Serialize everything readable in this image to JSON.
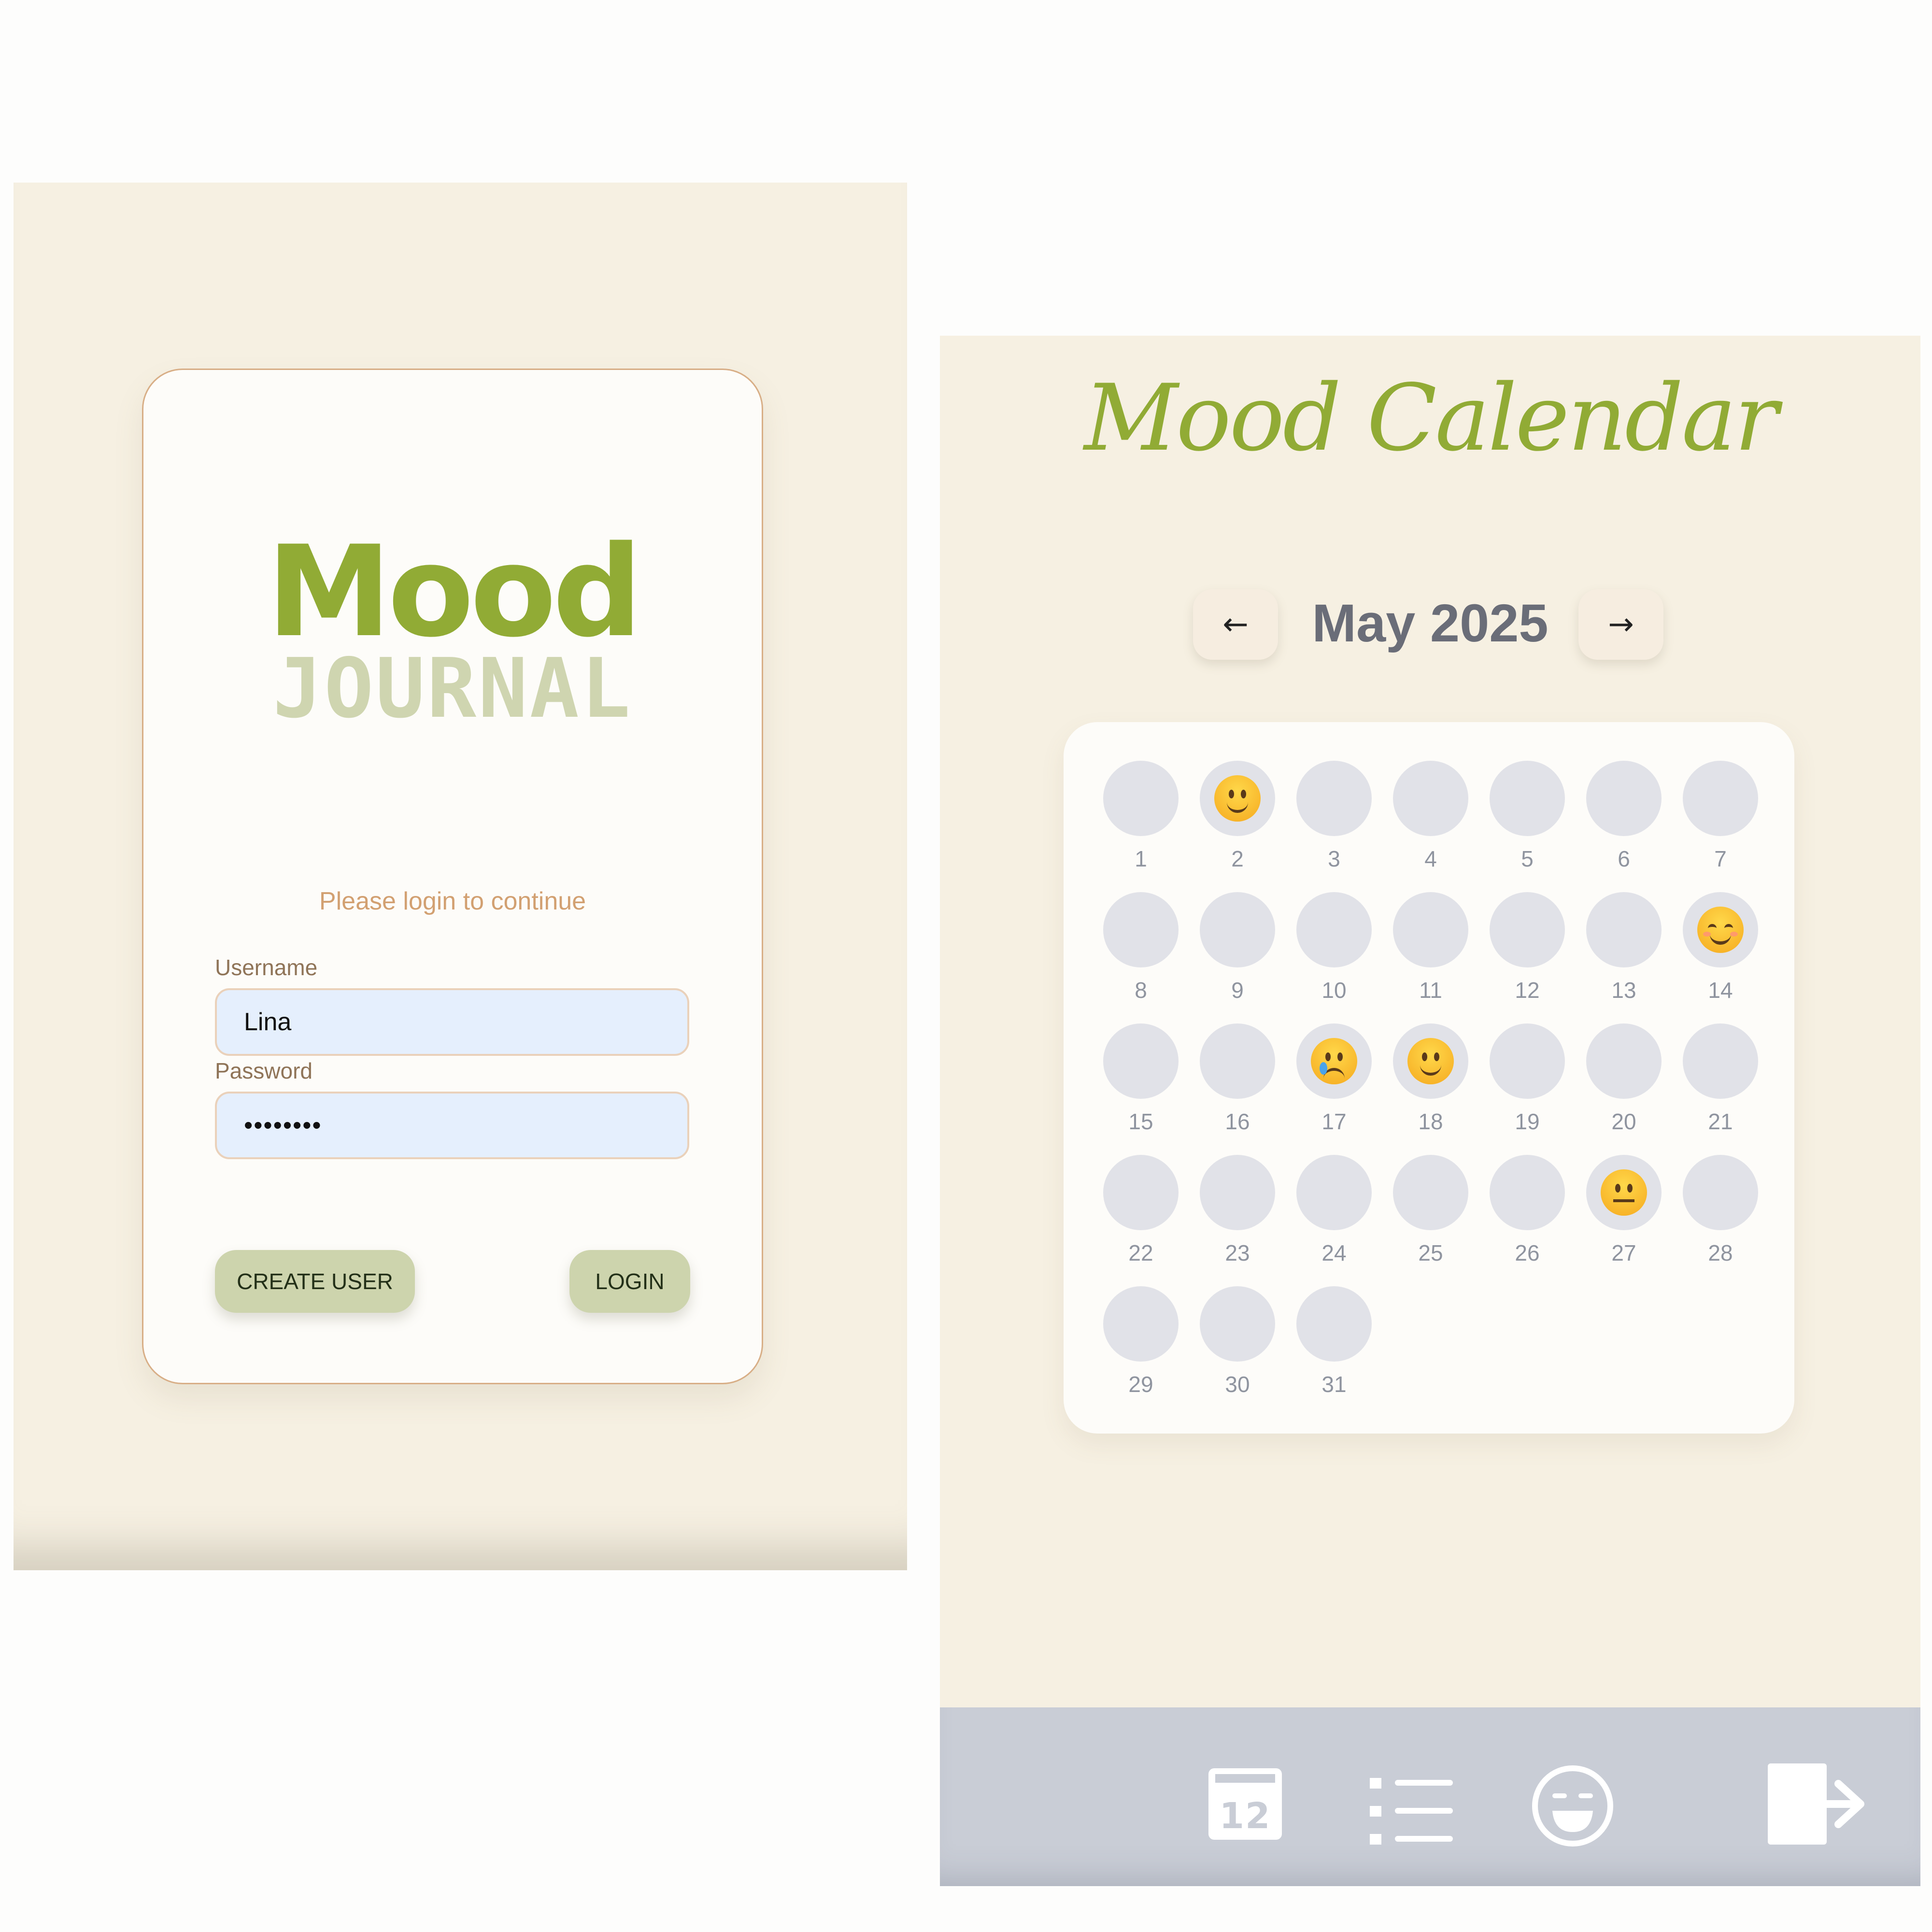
{
  "login": {
    "logo_top": "Mood",
    "logo_bottom": "JOURNAL",
    "prompt": "Please login to continue",
    "username_label": "Username",
    "username_value": "Lina",
    "password_label": "Password",
    "password_value": "••••••••",
    "create_user_label": "CREATE USER",
    "login_label": "LOGIN"
  },
  "calendar": {
    "title": "Mood Calendar",
    "month": "May 2025",
    "prev_label": "←",
    "next_label": "→",
    "days": [
      {
        "day": "1",
        "mood": ""
      },
      {
        "day": "2",
        "mood": "slight-smile"
      },
      {
        "day": "3",
        "mood": ""
      },
      {
        "day": "4",
        "mood": ""
      },
      {
        "day": "5",
        "mood": ""
      },
      {
        "day": "6",
        "mood": ""
      },
      {
        "day": "7",
        "mood": ""
      },
      {
        "day": "8",
        "mood": ""
      },
      {
        "day": "9",
        "mood": ""
      },
      {
        "day": "10",
        "mood": ""
      },
      {
        "day": "11",
        "mood": ""
      },
      {
        "day": "12",
        "mood": ""
      },
      {
        "day": "13",
        "mood": ""
      },
      {
        "day": "14",
        "mood": "smiling"
      },
      {
        "day": "15",
        "mood": ""
      },
      {
        "day": "16",
        "mood": ""
      },
      {
        "day": "17",
        "mood": "crying"
      },
      {
        "day": "18",
        "mood": "slight-smile"
      },
      {
        "day": "19",
        "mood": ""
      },
      {
        "day": "20",
        "mood": ""
      },
      {
        "day": "21",
        "mood": ""
      },
      {
        "day": "22",
        "mood": ""
      },
      {
        "day": "23",
        "mood": ""
      },
      {
        "day": "24",
        "mood": ""
      },
      {
        "day": "25",
        "mood": ""
      },
      {
        "day": "26",
        "mood": ""
      },
      {
        "day": "27",
        "mood": "neutral"
      },
      {
        "day": "28",
        "mood": ""
      },
      {
        "day": "29",
        "mood": ""
      },
      {
        "day": "30",
        "mood": ""
      },
      {
        "day": "31",
        "mood": ""
      }
    ]
  },
  "bottom_nav": {
    "calendar_icon_number": "12",
    "icons": [
      "calendar-icon",
      "list-icon",
      "mood-face-icon",
      "logout-icon"
    ]
  },
  "colors": {
    "brand_green": "#91ab35",
    "logo_journal": "#cfd5b0",
    "background": "#f6f0e2",
    "card": "#fdfcf9",
    "button": "#cdd4ad",
    "input": "#e5effd",
    "nav_bar": "#c9cdd6"
  }
}
